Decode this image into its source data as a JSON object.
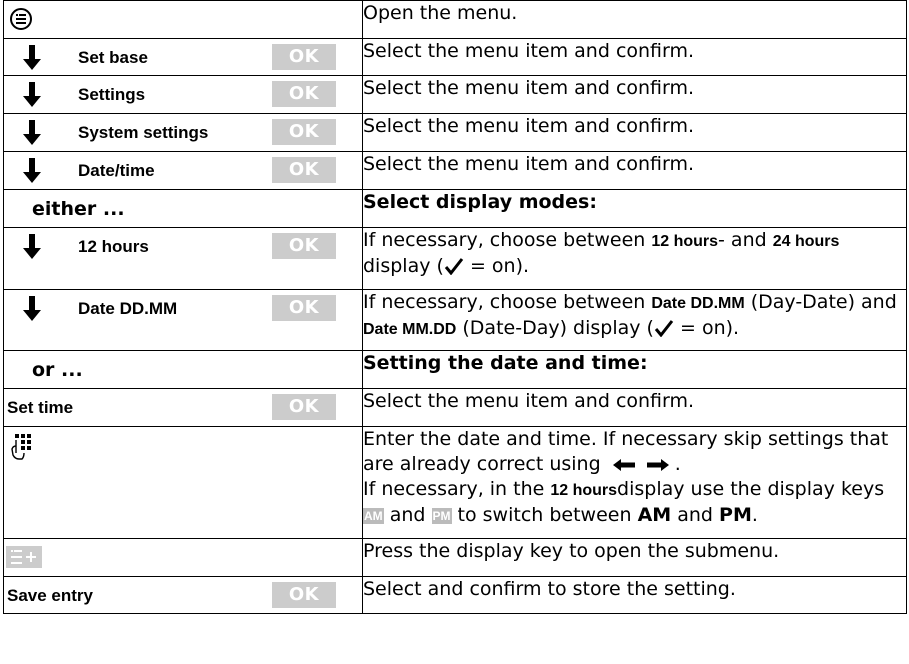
{
  "ok_label": "OK",
  "rows": {
    "menu": {
      "text": "Open the menu."
    },
    "set_base": {
      "item": "Set base",
      "text": "Select the menu item and confirm."
    },
    "settings": {
      "item": "Settings",
      "text": "Select the menu item and confirm."
    },
    "system_settings": {
      "item": "System settings",
      "text": "Select the menu item and confirm."
    },
    "date_time": {
      "item": "Date/time",
      "text": "Select the menu item and confirm."
    },
    "either": {
      "left": "either ...",
      "right": "Select display modes:"
    },
    "hours": {
      "item": "12 hours",
      "t1": "If necessary, choose between ",
      "k1": "12 hours",
      "t2": "- and ",
      "k2": "24 hours",
      "t3": "display (",
      "t4": " = on)."
    },
    "date_fmt": {
      "item": "Date DD.MM",
      "t1": "If necessary, choose between ",
      "k1": "Date DD.MM",
      "t2": " (Day-Date) and ",
      "k2": "Date MM.DD",
      "t3": " (Date-Day) display (",
      "t4": " = on)."
    },
    "or": {
      "left": "or ...",
      "right": "Setting the date and time:"
    },
    "set_time": {
      "item": "Set time",
      "text": "Select the menu item and confirm."
    },
    "enter": {
      "t1": "Enter the date and time. If necessary skip settings that are already correct using",
      "t1_end": ".",
      "t2": "If necessary, in the ",
      "k1": "12 hours",
      "t3": "display use the display keys ",
      "key_am": "AM",
      "t4": " and ",
      "key_pm": "PM",
      "t5": " to switch between ",
      "b_am": "AM",
      "t6": " and ",
      "b_pm": "PM",
      "t7": "."
    },
    "submenu": {
      "text": "Press the display key to open the submenu."
    },
    "save_entry": {
      "item": "Save entry",
      "text": "Select and confirm to store the setting."
    }
  }
}
